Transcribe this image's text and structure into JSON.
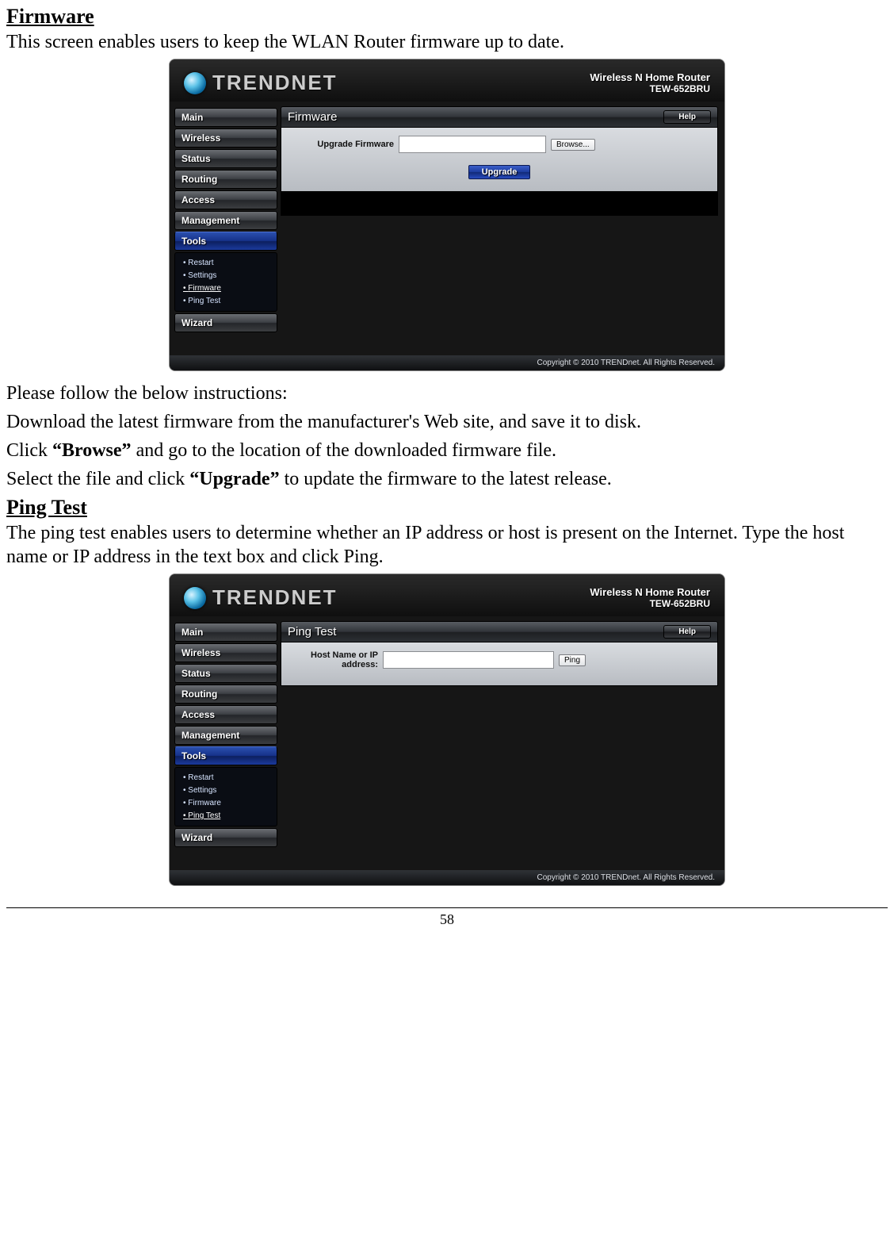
{
  "doc": {
    "firmware_heading": "Firmware",
    "firmware_intro": "This screen enables users to keep the WLAN Router firmware up to date.",
    "instructions_lead": "Please follow the below instructions:",
    "step_download": "Download the latest firmware from the manufacturer's Web site, and save it to disk.",
    "step_click_prefix": "Click ",
    "step_click_bold": "“Browse”",
    "step_click_suffix": " and go to the location of the downloaded firmware file.",
    "step_select_prefix": "Select the file and click ",
    "step_select_bold": "“Upgrade”",
    "step_select_suffix": " to update the firmware to the latest release.",
    "ping_heading": "Ping Test",
    "ping_intro": "The ping test enables users to determine whether an IP address or host is present on the Internet. Type the host name or IP address in the text box and click Ping.",
    "page_number": "58"
  },
  "router": {
    "brand": "TRENDNET",
    "product_title": "Wireless N Home Router",
    "product_model": "TEW-652BRU",
    "help_label": "Help",
    "footer": "Copyright © 2010 TRENDnet. All Rights Reserved.",
    "nav": {
      "main": "Main",
      "wireless": "Wireless",
      "status": "Status",
      "routing": "Routing",
      "access": "Access",
      "management": "Management",
      "tools": "Tools",
      "wizard": "Wizard"
    },
    "tools_sub": {
      "restart": "Restart",
      "settings": "Settings",
      "firmware": "Firmware",
      "ping_test": "Ping Test"
    },
    "firmware_panel": {
      "title": "Firmware",
      "field_label": "Upgrade Firmware",
      "browse_btn": "Browse...",
      "upgrade_btn": "Upgrade"
    },
    "ping_panel": {
      "title": "Ping Test",
      "field_label": "Host Name or IP address:",
      "ping_btn": "Ping"
    }
  }
}
